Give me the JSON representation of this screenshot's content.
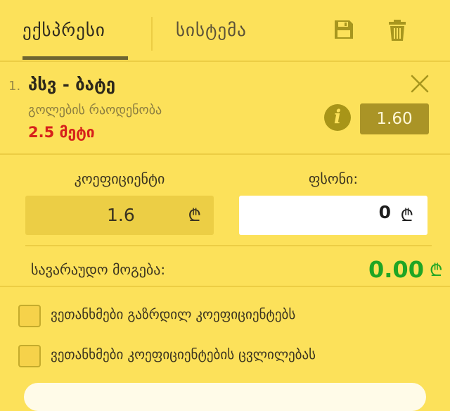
{
  "tabs": {
    "express": "ექსპრესი",
    "system": "სისტემა"
  },
  "icons": {
    "save": "save-icon",
    "trash": "trash-icon",
    "close": "close-icon",
    "info": "info-icon"
  },
  "bet": {
    "index": "1.",
    "match": "პსვ - ბატე",
    "market": "გოლების რაოდენობა",
    "selection": "2.5 მეტი",
    "info_symbol": "i",
    "odd": "1.60"
  },
  "stake": {
    "coef_label": "კოეფიციენტი",
    "stake_label": "ფსონი:",
    "coef_value": "1.6",
    "stake_value": "0",
    "currency": "₾"
  },
  "winnings": {
    "label": "სავარაუდო მოგება:",
    "amount": "0.00",
    "currency": "₾"
  },
  "options": [
    {
      "label": "ვეთანხმები გაზრდილ კოეფიციენტებს"
    },
    {
      "label": "ვეთანხმები კოეფიციენტების ცვლილებას"
    }
  ],
  "colors": {
    "background": "#fce15a",
    "accent_dark": "#aa9426",
    "win_green": "#1fa524",
    "selection_red": "#d6201b"
  }
}
